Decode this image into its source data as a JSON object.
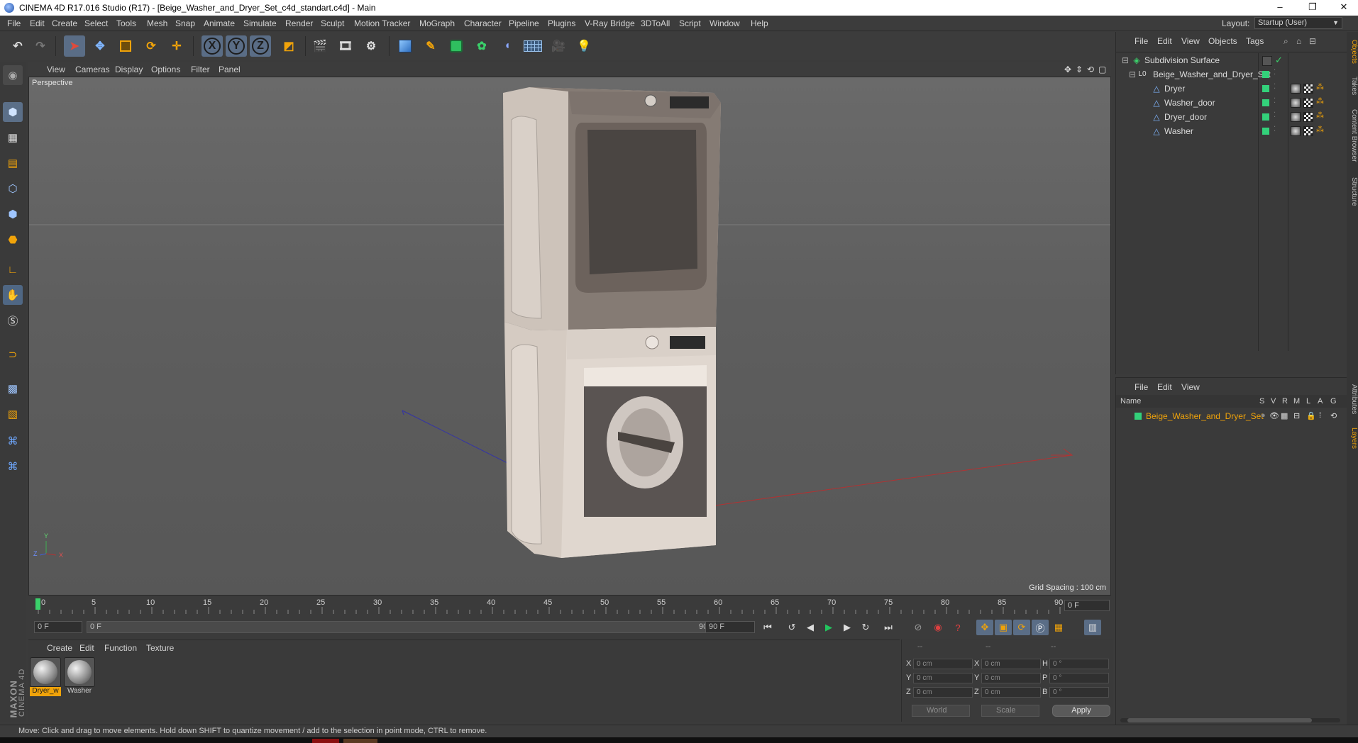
{
  "window": {
    "title": "CINEMA 4D R17.016 Studio (R17) - [Beige_Washer_and_Dryer_Set_c4d_standart.c4d] - Main",
    "controls": [
      "–",
      "❐",
      "✕"
    ]
  },
  "menubar": {
    "items": [
      "File",
      "Edit",
      "Create",
      "Select",
      "Tools",
      "Mesh",
      "Snap",
      "Animate",
      "Simulate",
      "Render",
      "Sculpt",
      "Motion Tracker",
      "MoGraph",
      "Character",
      "Pipeline",
      "Plugins",
      "V-Ray Bridge",
      "3DToAll",
      "Script",
      "Window",
      "Help"
    ],
    "layout_label": "Layout:",
    "layout_value": "Startup (User)"
  },
  "toolbar": {
    "axis_x": "X",
    "axis_y": "Y",
    "axis_z": "Z",
    "icons": [
      "undo-icon",
      "redo-icon",
      "select-pointer-icon",
      "move-icon",
      "scale-icon",
      "rotate-icon",
      "live-select-icon",
      "axis-x-icon",
      "axis-y-icon",
      "axis-z-icon",
      "coordinate-system-icon",
      "render-view-icon",
      "render-picture-viewer-icon",
      "render-settings-icon",
      "cube-primitive-icon",
      "pen-spline-icon",
      "subdivision-icon",
      "cloner-icon",
      "deformer-icon",
      "floor-grid-icon",
      "camera-icon",
      "light-icon"
    ]
  },
  "viewport": {
    "menu": [
      "View",
      "Cameras",
      "Display",
      "Options",
      "Filter",
      "Panel"
    ],
    "label": "Perspective",
    "grid_spacing": "Grid Spacing : 100 cm",
    "axis_labels": {
      "x": "X",
      "y": "Y",
      "z": "Z"
    }
  },
  "timeline": {
    "ticks": [
      "0",
      "5",
      "10",
      "15",
      "20",
      "25",
      "30",
      "35",
      "40",
      "45",
      "50",
      "55",
      "60",
      "65",
      "70",
      "75",
      "80",
      "85",
      "90"
    ],
    "current_frame": "0 F",
    "start_field": "0 F",
    "range_start": "0 F",
    "range_end": "90 F",
    "end_field": "90 F"
  },
  "material_manager": {
    "menu": [
      "Create",
      "Edit",
      "Function",
      "Texture"
    ],
    "materials": [
      {
        "label": "Dryer_w",
        "selected": true
      },
      {
        "label": "Washer",
        "selected": false
      }
    ]
  },
  "coordinates": {
    "headers": [
      "--",
      "--",
      "--"
    ],
    "rows": [
      {
        "a": "X",
        "a_val": "0 cm",
        "b": "X",
        "b_val": "0 cm",
        "c": "H",
        "c_val": "0 °"
      },
      {
        "a": "Y",
        "a_val": "0 cm",
        "b": "Y",
        "b_val": "0 cm",
        "c": "P",
        "c_val": "0 °"
      },
      {
        "a": "Z",
        "a_val": "0 cm",
        "b": "Z",
        "b_val": "0 cm",
        "c": "B",
        "c_val": "0 °"
      }
    ],
    "mode": "World",
    "transform": "Scale",
    "apply": "Apply"
  },
  "object_manager": {
    "menu": [
      "File",
      "Edit",
      "View",
      "Objects",
      "Tags"
    ],
    "objects": [
      {
        "name": "Subdivision Surface",
        "indent": 0,
        "icon": "subdivision-icon"
      },
      {
        "name": "Beige_Washer_and_Dryer_Set",
        "indent": 1,
        "icon": "null-object-icon"
      },
      {
        "name": "Dryer",
        "indent": 2,
        "icon": "polygon-object-icon"
      },
      {
        "name": "Washer_door",
        "indent": 2,
        "icon": "polygon-object-icon"
      },
      {
        "name": "Dryer_door",
        "indent": 2,
        "icon": "polygon-object-icon"
      },
      {
        "name": "Washer",
        "indent": 2,
        "icon": "polygon-object-icon"
      }
    ]
  },
  "layer_manager": {
    "menu": [
      "File",
      "Edit",
      "View"
    ],
    "columns": [
      "Name",
      "S",
      "V",
      "R",
      "M",
      "L",
      "A",
      "G"
    ],
    "layers": [
      {
        "name": "Beige_Washer_and_Dryer_Set",
        "color": "#33d17a"
      }
    ]
  },
  "right_tabs": [
    "Objects",
    "Takes",
    "Content Browser",
    "Structure",
    "Attributes",
    "Layers"
  ],
  "statusbar": {
    "text": "Move: Click and drag to move elements. Hold down SHIFT to quantize movement / add to the selection in point mode, CTRL to remove."
  },
  "logo": {
    "text1": "MAXON",
    "text2": "CINEMA 4D"
  },
  "colors": {
    "accent": "#5a6d86",
    "selection": "#f0a30a",
    "layer_green": "#33d17a",
    "play_green": "#22c55e"
  }
}
